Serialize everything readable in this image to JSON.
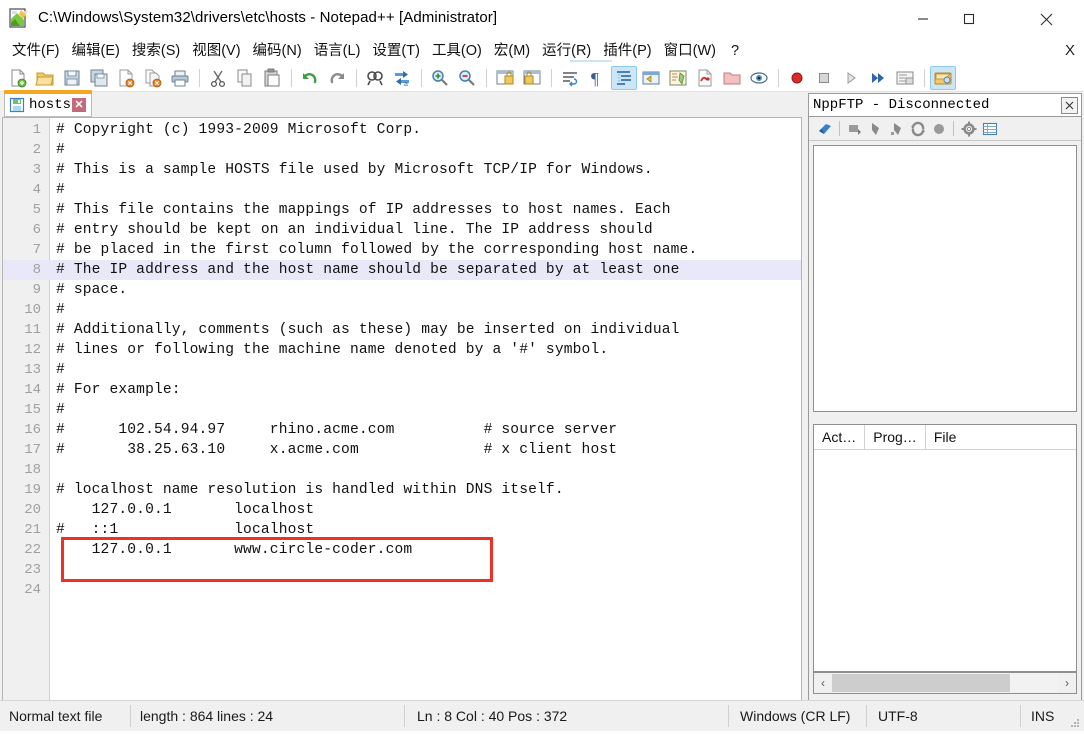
{
  "window": {
    "title": "C:\\Windows\\System32\\drivers\\etc\\hosts - Notepad++ [Administrator]",
    "app_icon": "notepadpp-icon",
    "minimize_label": "—",
    "maximize_label": "☐",
    "close_label": "✕"
  },
  "menubar": {
    "items": [
      {
        "label": "文件(F)",
        "name": "menu-file"
      },
      {
        "label": "编辑(E)",
        "name": "menu-edit"
      },
      {
        "label": "搜索(S)",
        "name": "menu-search"
      },
      {
        "label": "视图(V)",
        "name": "menu-view"
      },
      {
        "label": "编码(N)",
        "name": "menu-encoding"
      },
      {
        "label": "语言(L)",
        "name": "menu-language"
      },
      {
        "label": "设置(T)",
        "name": "menu-settings"
      },
      {
        "label": "工具(O)",
        "name": "menu-tools"
      },
      {
        "label": "宏(M)",
        "name": "menu-macro"
      },
      {
        "label": "运行(R)",
        "name": "menu-run"
      },
      {
        "label": "插件(P)",
        "name": "menu-plugins"
      },
      {
        "label": "窗口(W)",
        "name": "menu-window"
      },
      {
        "label": "?",
        "name": "menu-help"
      }
    ],
    "doc_close": "X"
  },
  "toolbar": {
    "buttons": [
      {
        "name": "new-file-icon",
        "title": "New"
      },
      {
        "name": "open-file-icon",
        "title": "Open"
      },
      {
        "name": "save-icon",
        "title": "Save"
      },
      {
        "name": "save-all-icon",
        "title": "Save All"
      },
      {
        "name": "close-file-icon",
        "title": "Close"
      },
      {
        "name": "close-all-icon",
        "title": "Close All"
      },
      {
        "name": "print-icon",
        "title": "Print"
      },
      {
        "name": "sep"
      },
      {
        "name": "cut-icon",
        "title": "Cut"
      },
      {
        "name": "copy-icon",
        "title": "Copy"
      },
      {
        "name": "paste-icon",
        "title": "Paste"
      },
      {
        "name": "sep"
      },
      {
        "name": "undo-icon",
        "title": "Undo"
      },
      {
        "name": "redo-icon",
        "title": "Redo"
      },
      {
        "name": "sep"
      },
      {
        "name": "find-icon",
        "title": "Find"
      },
      {
        "name": "replace-icon",
        "title": "Replace"
      },
      {
        "name": "sep"
      },
      {
        "name": "zoom-in-icon",
        "title": "Zoom In"
      },
      {
        "name": "zoom-out-icon",
        "title": "Zoom Out"
      },
      {
        "name": "sep"
      },
      {
        "name": "sync-vertical-icon",
        "title": "Synchronize Vertical"
      },
      {
        "name": "sync-horizontal-icon",
        "title": "Synchronize Horizontal"
      },
      {
        "name": "sep"
      },
      {
        "name": "word-wrap-icon",
        "title": "Word Wrap"
      },
      {
        "name": "show-all-chars-icon",
        "title": "Show All Characters"
      },
      {
        "name": "indent-guide-icon",
        "title": "Indent Guide",
        "active": true
      },
      {
        "name": "user-lang-icon",
        "title": "User Defined Language"
      },
      {
        "name": "doc-map-icon",
        "title": "Document Map"
      },
      {
        "name": "function-list-icon",
        "title": "Function List"
      },
      {
        "name": "folder-workspace-icon",
        "title": "Folder as Workspace"
      },
      {
        "name": "monitoring-icon",
        "title": "Monitoring"
      },
      {
        "name": "sep"
      },
      {
        "name": "record-macro-icon",
        "title": "Start Recording"
      },
      {
        "name": "stop-macro-icon",
        "title": "Stop Recording"
      },
      {
        "name": "play-macro-icon",
        "title": "Playback"
      },
      {
        "name": "run-multi-macro-icon",
        "title": "Run Macro Multiple Times"
      },
      {
        "name": "save-macro-icon",
        "title": "Save Current Recorded Macro"
      },
      {
        "name": "sep"
      },
      {
        "name": "show-nppftp-icon",
        "title": "Show NppFTP Window",
        "active": true
      }
    ]
  },
  "tab": {
    "label": "hosts",
    "icon": "saved-disk-icon",
    "close": "✕"
  },
  "editor": {
    "current_line": 8,
    "lines": [
      {
        "n": 1,
        "text": "# Copyright (c) 1993-2009 Microsoft Corp."
      },
      {
        "n": 2,
        "text": "#"
      },
      {
        "n": 3,
        "text": "# This is a sample HOSTS file used by Microsoft TCP/IP for Windows."
      },
      {
        "n": 4,
        "text": "#"
      },
      {
        "n": 5,
        "text": "# This file contains the mappings of IP addresses to host names. Each"
      },
      {
        "n": 6,
        "text": "# entry should be kept on an individual line. The IP address should"
      },
      {
        "n": 7,
        "text": "# be placed in the first column followed by the corresponding host name."
      },
      {
        "n": 8,
        "text": "# The IP address and the host name should be separated by at least one"
      },
      {
        "n": 9,
        "text": "# space."
      },
      {
        "n": 10,
        "text": "#"
      },
      {
        "n": 11,
        "text": "# Additionally, comments (such as these) may be inserted on individual"
      },
      {
        "n": 12,
        "text": "# lines or following the machine name denoted by a '#' symbol."
      },
      {
        "n": 13,
        "text": "#"
      },
      {
        "n": 14,
        "text": "# For example:"
      },
      {
        "n": 15,
        "text": "#"
      },
      {
        "n": 16,
        "text": "#      102.54.94.97     rhino.acme.com          # source server"
      },
      {
        "n": 17,
        "text": "#       38.25.63.10     x.acme.com              # x client host"
      },
      {
        "n": 18,
        "text": ""
      },
      {
        "n": 19,
        "text": "# localhost name resolution is handled within DNS itself."
      },
      {
        "n": 20,
        "text": "    127.0.0.1       localhost"
      },
      {
        "n": 21,
        "text": "#   ::1             localhost"
      },
      {
        "n": 22,
        "text": "    127.0.0.1       www.circle-coder.com"
      },
      {
        "n": 23,
        "text": ""
      },
      {
        "n": 24,
        "text": ""
      }
    ],
    "annotation": {
      "name": "red-highlight-box",
      "color": "#ee3124",
      "covers_lines": "22-23"
    }
  },
  "ftp_panel": {
    "title": "NppFTP - Disconnected",
    "close_label": "✕",
    "toolbar": [
      {
        "name": "ftp-connect-icon",
        "title": "(Dis)connect"
      },
      {
        "name": "sep"
      },
      {
        "name": "ftp-download-icon",
        "title": "Download"
      },
      {
        "name": "ftp-upload-icon",
        "title": "Upload"
      },
      {
        "name": "ftp-upload-other-icon",
        "title": "Upload other file"
      },
      {
        "name": "ftp-refresh-icon",
        "title": "Refresh"
      },
      {
        "name": "ftp-abort-icon",
        "title": "Abort"
      },
      {
        "name": "sep"
      },
      {
        "name": "ftp-settings-icon",
        "title": "Settings"
      },
      {
        "name": "ftp-messages-icon",
        "title": "Messages"
      }
    ],
    "tabs": [
      {
        "label": "Act…",
        "name": "ftp-tab-actions"
      },
      {
        "label": "Prog…",
        "name": "ftp-tab-progress"
      },
      {
        "label": "File",
        "name": "ftp-tab-file"
      }
    ],
    "scroll_left": "‹",
    "scroll_right": "›"
  },
  "statusbar": {
    "file_type": "Normal text file",
    "length_lines": "length : 864    lines : 24",
    "position": "Ln : 8    Col : 40    Pos : 372",
    "eol": "Windows (CR LF)",
    "encoding": "UTF-8",
    "insert_mode": "INS"
  }
}
